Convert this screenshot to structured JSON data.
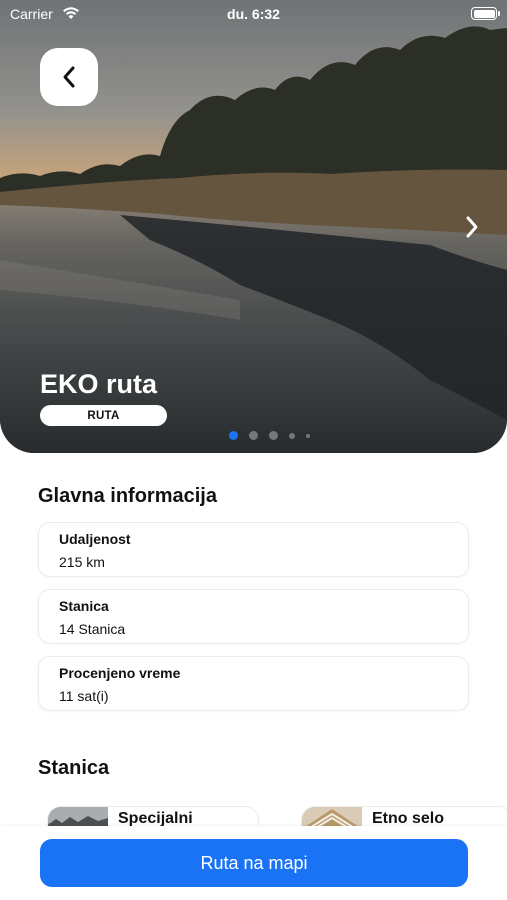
{
  "status_bar": {
    "carrier": "Carrier",
    "time": "du. 6:32"
  },
  "hero": {
    "title": "EKO ruta",
    "badge": "RUTA",
    "pager": {
      "total": 5,
      "active": 0
    }
  },
  "main_info": {
    "title": "Glavna informacija",
    "items": [
      {
        "label": "Udaljenost",
        "value": "215 km"
      },
      {
        "label": "Stanica",
        "value": "14 Stanica"
      },
      {
        "label": "Procenjeno vreme",
        "value": "11 sat(i)"
      }
    ]
  },
  "stations": {
    "title": "Stanica",
    "items": [
      {
        "name": "Specijalni"
      },
      {
        "name": "Etno selo"
      }
    ]
  },
  "map_button": {
    "label": "Ruta na mapi"
  },
  "colors": {
    "accent": "#1a73f5",
    "background": "#ffffff",
    "text": "#111111"
  }
}
